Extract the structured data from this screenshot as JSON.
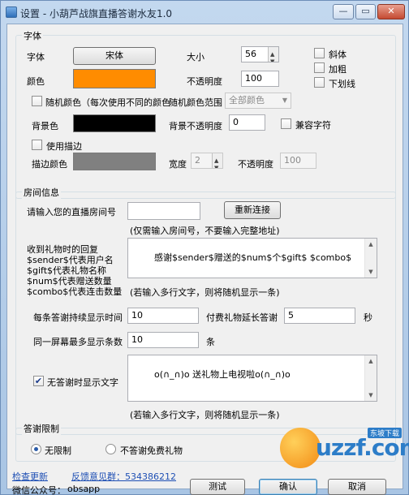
{
  "window": {
    "title": "设置 - 小葫芦战旗直播答谢水友1.0",
    "minimize": "—",
    "maximize": "▭",
    "close": "✕"
  },
  "font_group": {
    "title": "字体",
    "font_label": "字体",
    "font_button": "宋体",
    "size_label": "大小",
    "size_value": "56",
    "italic": "斜体",
    "bold": "加粗",
    "underline": "下划线",
    "color_label": "颜色",
    "color_value": "#ff8c00",
    "opacity_label": "不透明度",
    "opacity_value": "100",
    "random_color_label": "随机颜色（每次使用不同的颜色",
    "random_range_label": "随机颜色范围",
    "random_range_value": "全部颜色",
    "bg_label": "背景色",
    "bg_color": "#000000",
    "bg_opacity_label": "背景不透明度",
    "bg_opacity_value": "0",
    "compat_label": "兼容字符",
    "use_stroke_label": "使用描边",
    "stroke_color_label": "描边颜色",
    "stroke_color": "#808080",
    "width_label": "宽度",
    "width_value": "2",
    "stroke_opacity_label": "不透明度",
    "stroke_opacity_value": "100"
  },
  "room_group": {
    "title": "房间信息",
    "room_label": "请输入您的直播房间号",
    "room_value": "",
    "reconnect_button": "重新连接",
    "room_hint": "(仅需输入房间号，不要输入完整地址)",
    "reply_label_lines": [
      "收到礼物时的回复",
      "$sender$代表用户名",
      "$gift$代表礼物名称",
      "$num$代表赠送数量",
      "$combo$代表连击数量"
    ],
    "reply_value": "感谢$sender$赠送的$num$个$gift$ $combo$",
    "multiline_hint": "(若输入多行文字，则将随机显示一条)",
    "duration_label": "每条答谢持续显示时间",
    "duration_value": "10",
    "paid_extend_label": "付费礼物延长答谢",
    "paid_extend_value": "5",
    "seconds_unit": "秒",
    "max_lines_label": "同一屏幕最多显示条数",
    "max_lines_value": "10",
    "lines_unit": "条",
    "idle_label": "无答谢时显示文字",
    "idle_value": "o(∩_∩)o 送礼物上电视啦o(∩_∩)o",
    "multiline_hint2": "(若输入多行文字，则将随机显示一条)"
  },
  "limit_group": {
    "title": "答谢限制",
    "option_unlimited": "无限制",
    "option_no_free": "不答谢免费礼物"
  },
  "footer": {
    "check_update": "检查更新",
    "feedback": "反馈意见群：534386212",
    "wechat_label": "微信公众号：",
    "wechat_value": "obsapp",
    "test_button": "测试",
    "ok_button": "确认",
    "cancel_button": "取消"
  },
  "watermark": {
    "text": "uzzf.com",
    "badge": "东坡下载"
  }
}
